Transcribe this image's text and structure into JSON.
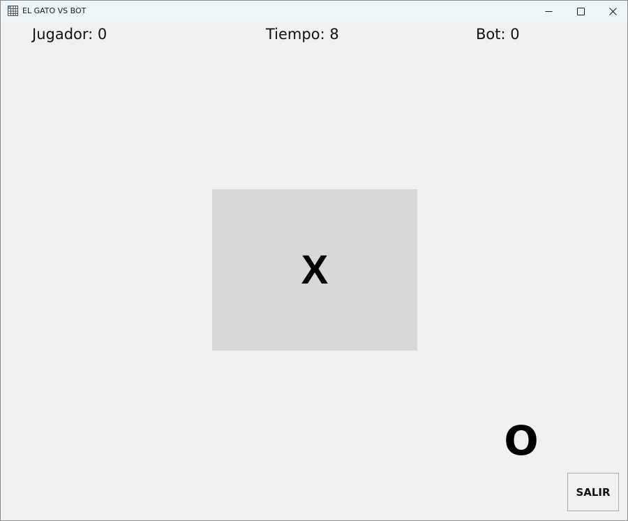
{
  "window": {
    "title": "EL GATO VS BOT",
    "app_icon": "grid-icon",
    "controls": [
      "minimize-icon",
      "maximize-icon",
      "close-icon"
    ]
  },
  "scoreboard": {
    "player": "Jugador: 0",
    "time": "Tiempo: 8",
    "bot": "Bot: 0"
  },
  "board": {
    "cell_mark": "X"
  },
  "bot_mark": "O",
  "exit_button": {
    "label": "SALIR"
  },
  "colors": {
    "titlebar": "#eef5f9",
    "background": "#f0f0f0",
    "cell": "#d8d8d8",
    "text": "#000000"
  }
}
